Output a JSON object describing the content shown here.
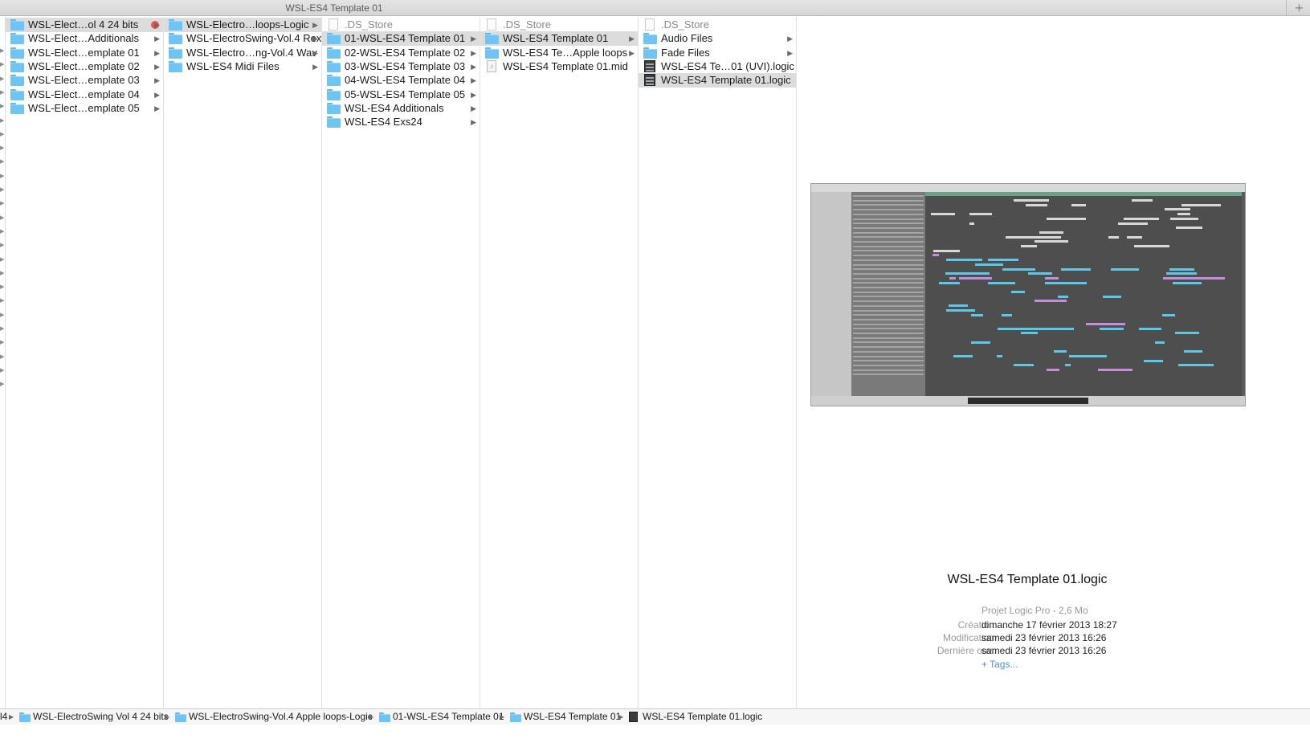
{
  "window": {
    "tab_title": "WSL-ES4 Template 01",
    "new_tab_glyph": "+"
  },
  "columns": [
    {
      "items": [
        {
          "label": "WSL-Elect…ol 4 24 bits",
          "icon": "folder-icon",
          "arrow": "▶",
          "selected": true,
          "tag_color": "#f05050"
        },
        {
          "label": "WSL-Elect…Additionals",
          "icon": "folder-icon",
          "arrow": "▶"
        },
        {
          "label": "WSL-Elect…emplate 01",
          "icon": "folder-icon",
          "arrow": "▶"
        },
        {
          "label": "WSL-Elect…emplate 02",
          "icon": "folder-icon",
          "arrow": "▶"
        },
        {
          "label": "WSL-Elect…emplate 03",
          "icon": "folder-icon",
          "arrow": "▶"
        },
        {
          "label": "WSL-Elect…emplate 04",
          "icon": "folder-icon",
          "arrow": "▶"
        },
        {
          "label": "WSL-Elect…emplate 05",
          "icon": "folder-icon",
          "arrow": "▶"
        }
      ]
    },
    {
      "items": [
        {
          "label": "WSL-Electro…loops-Logic",
          "icon": "folder-icon",
          "arrow": "▶",
          "selected": true
        },
        {
          "label": "WSL-ElectroSwing-Vol.4 Rex",
          "icon": "folder-icon",
          "arrow": "▶"
        },
        {
          "label": "WSL-Electro…ng-Vol.4 Wav",
          "icon": "folder-icon",
          "arrow": "▶"
        },
        {
          "label": "WSL-ES4 Midi Files",
          "icon": "folder-icon",
          "arrow": "▶"
        }
      ]
    },
    {
      "items": [
        {
          "label": ".DS_Store",
          "icon": "document-icon",
          "dim": true
        },
        {
          "label": "01-WSL-ES4 Template 01",
          "icon": "folder-icon",
          "arrow": "▶",
          "selected": true
        },
        {
          "label": "02-WSL-ES4 Template 02",
          "icon": "folder-icon",
          "arrow": "▶"
        },
        {
          "label": "03-WSL-ES4 Template 03",
          "icon": "folder-icon",
          "arrow": "▶"
        },
        {
          "label": "04-WSL-ES4 Template 04",
          "icon": "folder-icon",
          "arrow": "▶"
        },
        {
          "label": "05-WSL-ES4 Template 05",
          "icon": "folder-icon",
          "arrow": "▶"
        },
        {
          "label": "WSL-ES4 Additionals",
          "icon": "folder-icon",
          "arrow": "▶"
        },
        {
          "label": "WSL-ES4 Exs24",
          "icon": "folder-icon",
          "arrow": "▶"
        }
      ]
    },
    {
      "items": [
        {
          "label": ".DS_Store",
          "icon": "document-icon",
          "dim": true
        },
        {
          "label": "WSL-ES4 Template 01",
          "icon": "folder-icon",
          "arrow": "▶",
          "selected": true
        },
        {
          "label": "WSL-ES4 Te…Apple loops",
          "icon": "folder-icon",
          "arrow": "▶"
        },
        {
          "label": "WSL-ES4 Template 01.mid",
          "icon": "midi-file-icon"
        }
      ]
    },
    {
      "items": [
        {
          "label": ".DS_Store",
          "icon": "document-icon",
          "dim": true
        },
        {
          "label": "Audio Files",
          "icon": "folder-icon",
          "arrow": "▶"
        },
        {
          "label": "Fade Files",
          "icon": "folder-icon",
          "arrow": "▶"
        },
        {
          "label": "WSL-ES4 Te…01 (UVI).logic",
          "icon": "logic-project-icon"
        },
        {
          "label": "WSL-ES4 Template 01.logic",
          "icon": "logic-project-icon",
          "selected": true
        }
      ]
    }
  ],
  "preview": {
    "filename": "WSL-ES4 Template 01.logic",
    "kind": "Projet Logic Pro - 2,6 Mo",
    "info": [
      {
        "key": "Création",
        "value": "dimanche 17 février 2013 18:27"
      },
      {
        "key": "Modification",
        "value": "samedi 23 février 2013 16:26"
      },
      {
        "key": "Dernière ouv.",
        "value": "samedi 23 février 2013 16:26"
      }
    ],
    "tags_link": "+ Tags..."
  },
  "pathbar": {
    "leading_fragment": "l4",
    "items": [
      {
        "label": "WSL-ElectroSwing Vol 4 24 bits",
        "icon": "folder-icon"
      },
      {
        "label": "WSL-ElectroSwing-Vol.4 Apple loops-Logic",
        "icon": "folder-icon"
      },
      {
        "label": "01-WSL-ES4 Template 01",
        "icon": "folder-icon"
      },
      {
        "label": "WSL-ES4 Template 01",
        "icon": "folder-icon"
      },
      {
        "label": "WSL-ES4 Template 01.logic",
        "icon": "logic-project-icon"
      }
    ],
    "separator": "▶"
  },
  "colors": {
    "folder": "#6ec4f5",
    "selection": "#dcdcdc",
    "tag_red": "#f05050",
    "link": "#4a90d9"
  }
}
